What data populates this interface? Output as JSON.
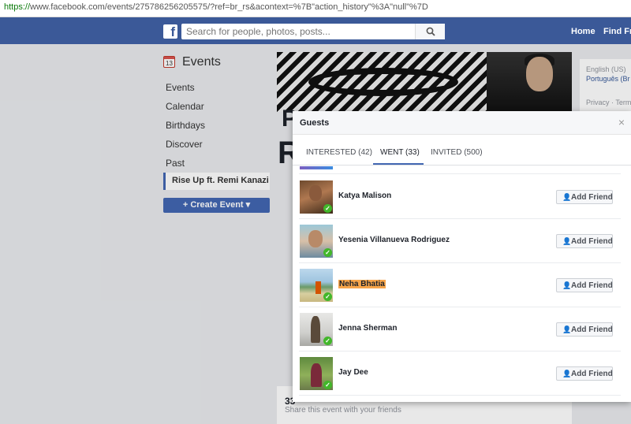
{
  "browser": {
    "url_scheme": "https://",
    "url_rest": "www.facebook.com/events/275786256205575/?ref=br_rs&acontext=%7B\"action_history\"%3A\"null\"%7D"
  },
  "topnav": {
    "logo": "f",
    "search_placeholder": "Search for people, photos, posts...",
    "home": "Home",
    "find_friends": "Find Fri"
  },
  "sidebar": {
    "title": "Events",
    "calendar_day": "13",
    "items": [
      {
        "label": "Events"
      },
      {
        "label": "Calendar"
      },
      {
        "label": "Birthdays"
      },
      {
        "label": "Discover"
      },
      {
        "label": "Past"
      }
    ],
    "active_event": "Rise Up ft. Remi Kanazi",
    "create_button": "+ Create Event ▾"
  },
  "background": {
    "title_fragment": "P",
    "title_fragment2": "R",
    "guest_count": "33",
    "share_text": "Share this event with your friends"
  },
  "right_column": {
    "lang": "English (US)",
    "lang_alt": "Português (Br",
    "links": "Privacy · Term"
  },
  "modal": {
    "title": "Guests",
    "close": "×",
    "tabs": [
      {
        "label": "INTERESTED (42)"
      },
      {
        "label": "WENT (33)"
      },
      {
        "label": "INVITED (500)"
      }
    ],
    "add_friend_label": "Add Friend",
    "guests": [
      {
        "name": "Katya Malison"
      },
      {
        "name": "Yesenia Villanueva Rodriguez"
      },
      {
        "name": "Neha Bhatia"
      },
      {
        "name": "Jenna Sherman"
      },
      {
        "name": "Jay Dee"
      }
    ]
  }
}
